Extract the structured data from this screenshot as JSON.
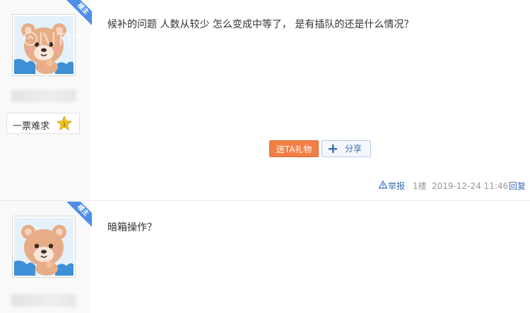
{
  "posts": [
    {
      "role_badge": "楼主",
      "rank": {
        "title": "一票难求",
        "level": "1"
      },
      "content": "候补的问题 人数从较少 怎么变成中等了， 是有插队的还是什么情况？",
      "actions": {
        "gift_label": "送TA礼物",
        "share_label": "分享"
      },
      "footer": {
        "report_label": "举报",
        "floor": "1楼",
        "time": "2019-12-24 11:46",
        "reply_label": "回复"
      }
    },
    {
      "role_badge": "楼主",
      "content": "暗箱操作？"
    }
  ],
  "colors": {
    "badge_blue": "#4f8ee8",
    "gift_orange": "#f07e45",
    "link_blue": "#3a6cb3",
    "star_yellow": "#f5c518"
  },
  "icons": {
    "avatar": "bear-avatar",
    "rank": "star-icon",
    "share": "plus-icon",
    "report": "warning-icon"
  }
}
